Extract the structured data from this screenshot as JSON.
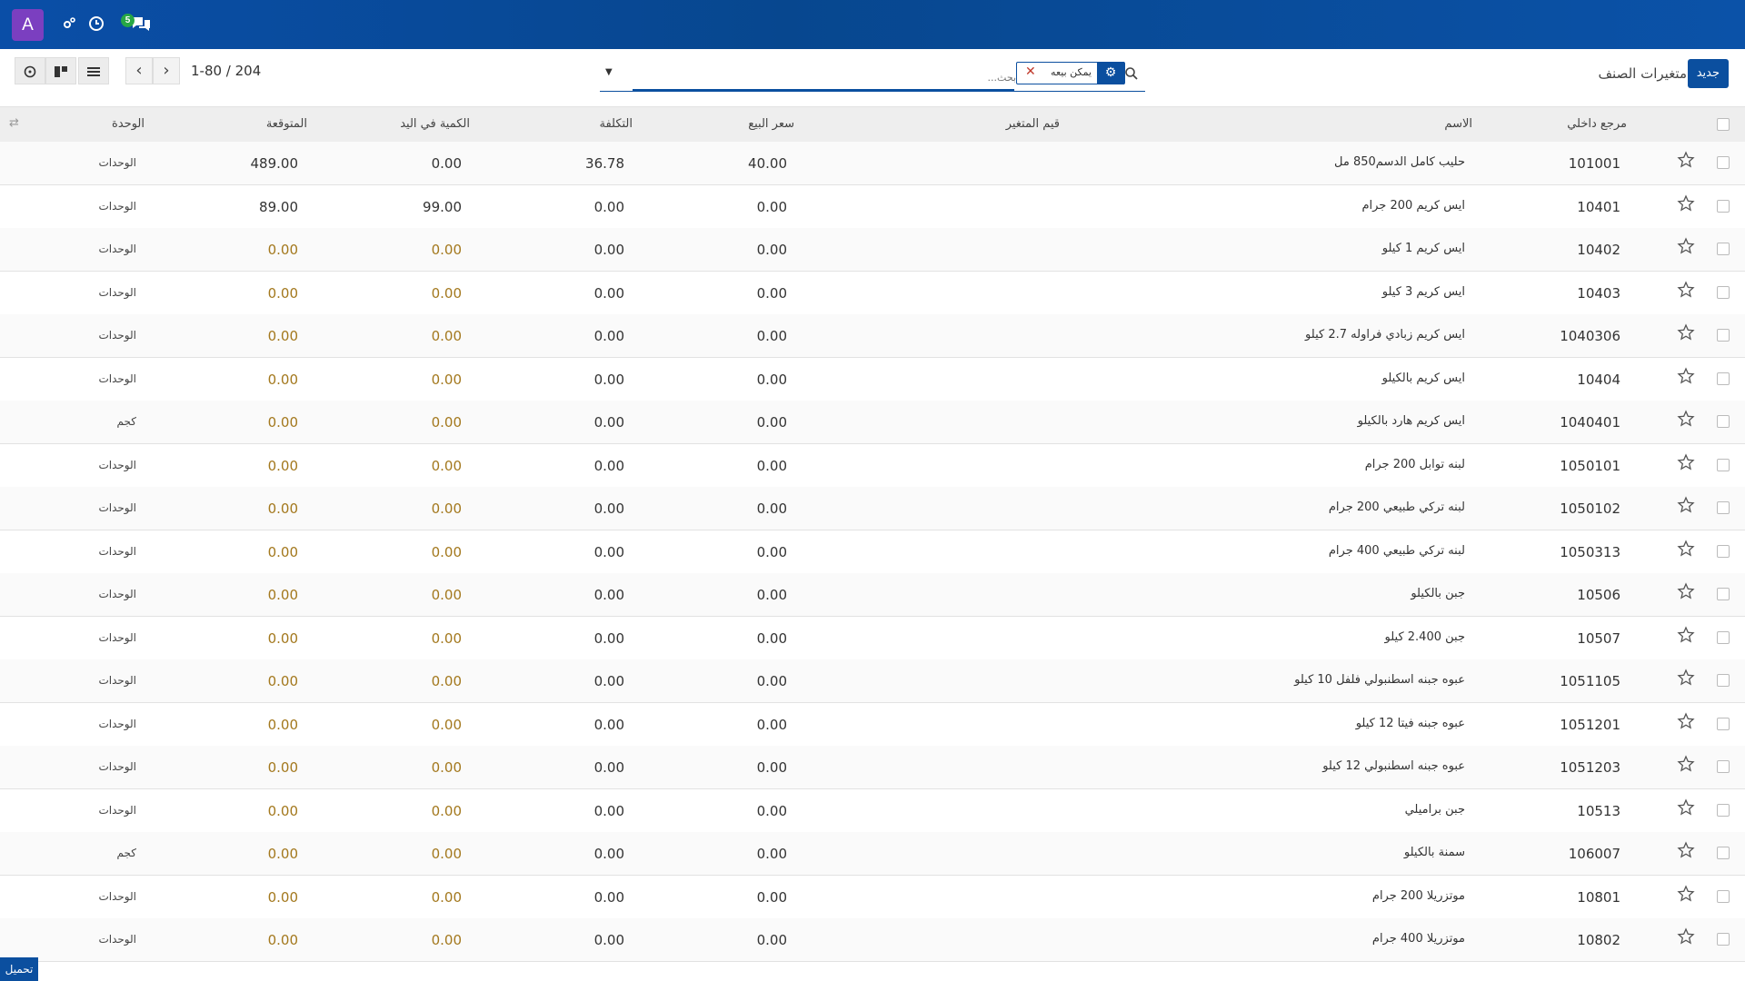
{
  "navbar": {
    "avatar_letter": "A",
    "chat_badge": "5",
    "icons": [
      "settings-cog-icon",
      "clock-icon",
      "chat-icon"
    ]
  },
  "control_panel": {
    "new_button": "جديد",
    "breadcrumb": "متغيرات الصنف",
    "search_placeholder": "بحث...",
    "facet_label": "يمكن بيعه",
    "pager_text": "1-80 / 204"
  },
  "table": {
    "headers": {
      "ref": "مرجع داخلي",
      "name": "الاسم",
      "variant": "قيم المتغير",
      "price": "سعر البيع",
      "cost": "التكلفة",
      "qty": "الكمية في اليد",
      "forecast": "المتوقعة",
      "unit": "الوحدة"
    },
    "rows": [
      {
        "ref": "101001",
        "name": "حليب كامل الدسم850 مل",
        "price": "40.00",
        "cost": "36.78",
        "qty": "0.00",
        "forecast": "489.00",
        "unit": "الوحدات",
        "warn": false
      },
      {
        "ref": "10401",
        "name": "ايس كريم 200 جرام",
        "price": "0.00",
        "cost": "0.00",
        "qty": "99.00",
        "forecast": "89.00",
        "unit": "الوحدات",
        "warn": false
      },
      {
        "ref": "10402",
        "name": "ايس كريم 1 كيلو",
        "price": "0.00",
        "cost": "0.00",
        "qty": "0.00",
        "forecast": "0.00",
        "unit": "الوحدات",
        "warn": true
      },
      {
        "ref": "10403",
        "name": "ايس كريم 3 كيلو",
        "price": "0.00",
        "cost": "0.00",
        "qty": "0.00",
        "forecast": "0.00",
        "unit": "الوحدات",
        "warn": true
      },
      {
        "ref": "1040306",
        "name": "ايس كريم زبادي فراوله 2.7 كيلو",
        "price": "0.00",
        "cost": "0.00",
        "qty": "0.00",
        "forecast": "0.00",
        "unit": "الوحدات",
        "warn": true
      },
      {
        "ref": "10404",
        "name": "ايس كريم بالكيلو",
        "price": "0.00",
        "cost": "0.00",
        "qty": "0.00",
        "forecast": "0.00",
        "unit": "الوحدات",
        "warn": true
      },
      {
        "ref": "1040401",
        "name": "ايس كريم هارد بالكيلو",
        "price": "0.00",
        "cost": "0.00",
        "qty": "0.00",
        "forecast": "0.00",
        "unit": "كجم",
        "warn": true
      },
      {
        "ref": "1050101",
        "name": "لبنه توابل 200 جرام",
        "price": "0.00",
        "cost": "0.00",
        "qty": "0.00",
        "forecast": "0.00",
        "unit": "الوحدات",
        "warn": true
      },
      {
        "ref": "1050102",
        "name": "لبنه تركي طبيعي 200 جرام",
        "price": "0.00",
        "cost": "0.00",
        "qty": "0.00",
        "forecast": "0.00",
        "unit": "الوحدات",
        "warn": true
      },
      {
        "ref": "1050313",
        "name": "لبنه تركي طبيعي 400 جرام",
        "price": "0.00",
        "cost": "0.00",
        "qty": "0.00",
        "forecast": "0.00",
        "unit": "الوحدات",
        "warn": true
      },
      {
        "ref": "10506",
        "name": "جبن بالكيلو",
        "price": "0.00",
        "cost": "0.00",
        "qty": "0.00",
        "forecast": "0.00",
        "unit": "الوحدات",
        "warn": true
      },
      {
        "ref": "10507",
        "name": "جبن 2.400 كيلو",
        "price": "0.00",
        "cost": "0.00",
        "qty": "0.00",
        "forecast": "0.00",
        "unit": "الوحدات",
        "warn": true
      },
      {
        "ref": "1051105",
        "name": "عبوه جبنه اسطنبولي فلفل 10 كيلو",
        "price": "0.00",
        "cost": "0.00",
        "qty": "0.00",
        "forecast": "0.00",
        "unit": "الوحدات",
        "warn": true
      },
      {
        "ref": "1051201",
        "name": "عبوه جبنه فيتا 12 كيلو",
        "price": "0.00",
        "cost": "0.00",
        "qty": "0.00",
        "forecast": "0.00",
        "unit": "الوحدات",
        "warn": true
      },
      {
        "ref": "1051203",
        "name": "عبوه جبنه اسطنبولي 12 كيلو",
        "price": "0.00",
        "cost": "0.00",
        "qty": "0.00",
        "forecast": "0.00",
        "unit": "الوحدات",
        "warn": true
      },
      {
        "ref": "10513",
        "name": "جبن براميلي",
        "price": "0.00",
        "cost": "0.00",
        "qty": "0.00",
        "forecast": "0.00",
        "unit": "الوحدات",
        "warn": true
      },
      {
        "ref": "106007",
        "name": "سمنة بالكيلو",
        "price": "0.00",
        "cost": "0.00",
        "qty": "0.00",
        "forecast": "0.00",
        "unit": "كجم",
        "warn": true
      },
      {
        "ref": "10801",
        "name": "موتزريلا 200 جرام",
        "price": "0.00",
        "cost": "0.00",
        "qty": "0.00",
        "forecast": "0.00",
        "unit": "الوحدات",
        "warn": true
      },
      {
        "ref": "10802",
        "name": "موتزريلا 400 جرام",
        "price": "0.00",
        "cost": "0.00",
        "qty": "0.00",
        "forecast": "0.00",
        "unit": "الوحدات",
        "warn": true
      }
    ]
  },
  "footer": {
    "load_button": "تحميل"
  },
  "colors": {
    "navbar": "#0a4ea7",
    "accent": "#0b4f9f",
    "warning_text": "#a3781d",
    "avatar": "#7b3fc0"
  }
}
